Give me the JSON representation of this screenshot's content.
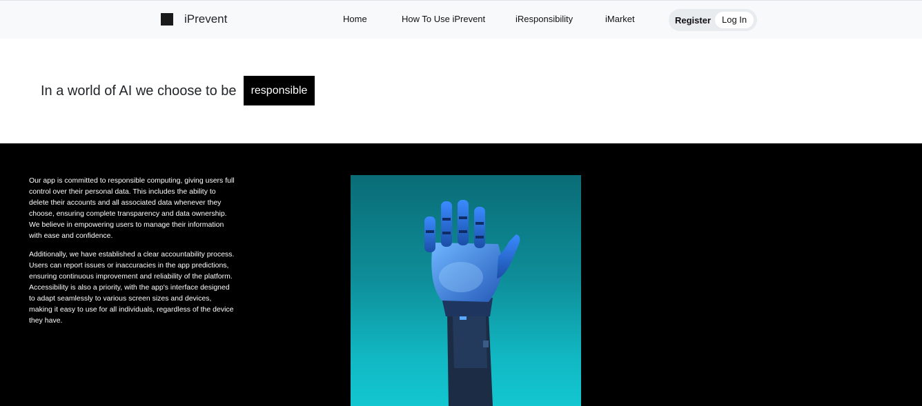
{
  "navbar": {
    "brand": "iPrevent",
    "links": [
      {
        "label": "Home"
      },
      {
        "label": "How To Use iPrevent"
      },
      {
        "label": "iResponsibility"
      },
      {
        "label": "iMarket"
      }
    ],
    "register_label": "Register",
    "login_label": "Log In"
  },
  "hero": {
    "text": "In a world of AI we choose to be",
    "highlight": "responsible"
  },
  "info": {
    "paragraphs": [
      "Our app is committed to responsible computing, giving users full control over their personal data. This includes the ability to delete their accounts and all associated data whenever they choose, ensuring complete transparency and data ownership. We believe in empowering users to manage their information with ease and confidence.",
      "Additionally, we have established a clear accountability process. Users can report issues or inaccuracies in the app predictions, ensuring continuous improvement and reliability of the platform. Accessibility is also a priority, with the app's interface designed to adapt seamlessly to various screen sizes and devices, making it easy to use for all individuals, regardless of the device they have."
    ]
  },
  "colors": {
    "navbar_bg": "#f8f9fa",
    "info_bg": "#000000",
    "photo_top": "#0a6c76",
    "photo_bottom": "#13c6d0",
    "hand": "#2a6fd6"
  }
}
